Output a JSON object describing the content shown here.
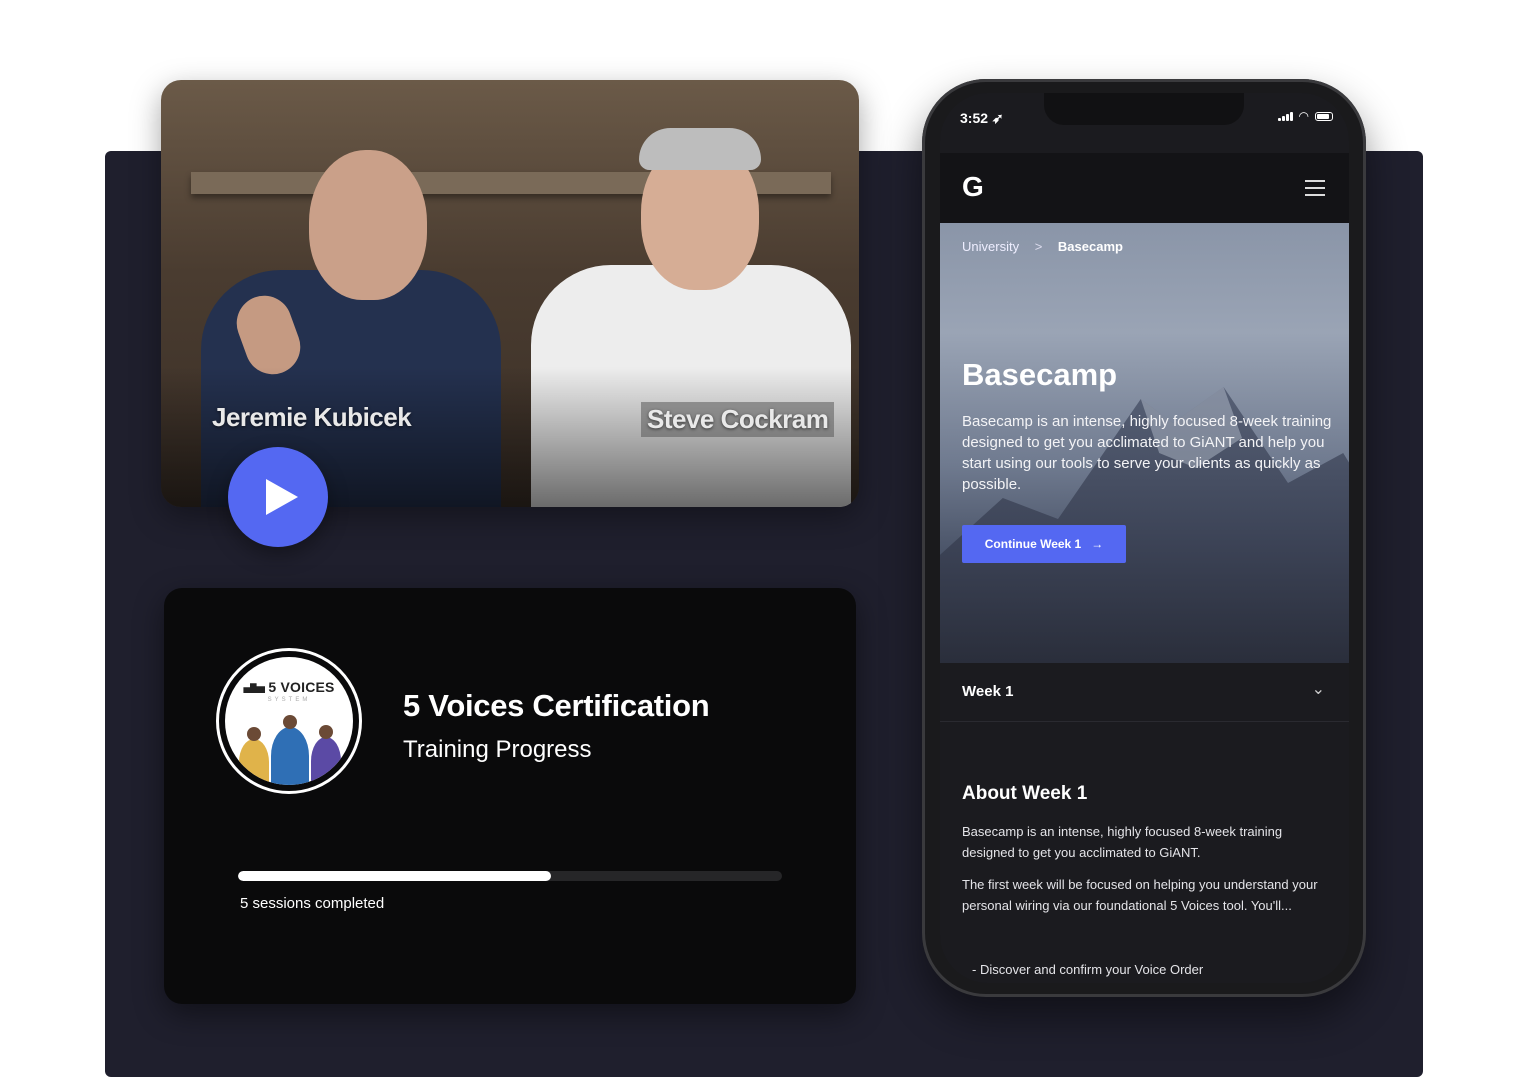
{
  "video": {
    "presenter_left": "Jeremie Kubicek",
    "presenter_right": "Steve Cockram"
  },
  "certification": {
    "badge_logo": "5 VOICES",
    "badge_sub": "SYSTEM",
    "title": "5 Voices Certification",
    "subtitle": "Training Progress",
    "progress_fraction": 0.575,
    "progress_label": "5 sessions completed"
  },
  "phone": {
    "status_time": "3:52",
    "logo": "G",
    "breadcrumb": {
      "parent": "University",
      "separator": ">",
      "current": "Basecamp"
    },
    "hero_title": "Basecamp",
    "hero_description": "Basecamp is an intense, highly focused 8-week training designed to get you acclimated to GiANT and help you start using our tools to serve your clients as quickly as possible.",
    "cta_label": "Continue Week 1",
    "cta_arrow": "→",
    "accordion_label": "Week 1",
    "accordion_chevron": "⌄",
    "about_title": "About Week 1",
    "about_p1": "Basecamp is an intense, highly focused 8-week training designed to get you acclimated to GiANT.",
    "about_p2": "The first week will be focused on helping you understand your personal wiring via our foundational 5 Voices tool. You'll...",
    "about_list_item": "- Discover and confirm your Voice Order"
  },
  "colors": {
    "accent": "#5468f2",
    "stage_bg": "#1f1f2d",
    "card_bg": "#0a0a0b"
  },
  "icons": [
    "play-icon",
    "menu-icon",
    "chevron-down-icon",
    "arrow-right-icon",
    "location-arrow-icon",
    "signal-icon",
    "wifi-icon",
    "battery-icon"
  ]
}
